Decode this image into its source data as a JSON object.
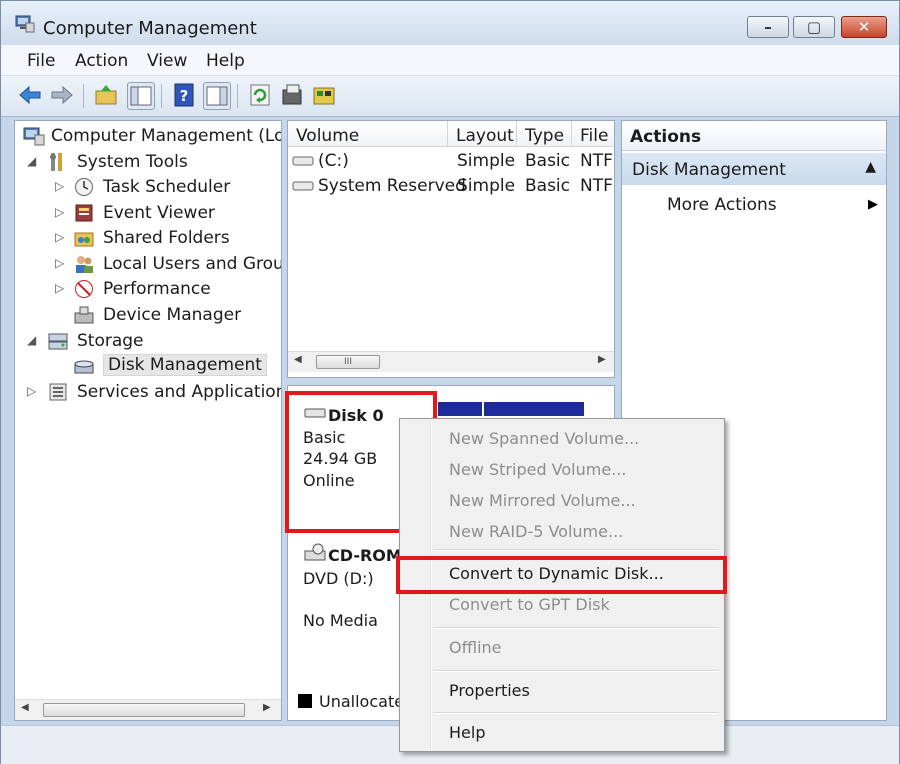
{
  "window": {
    "title": "Computer Management",
    "min_label": "–",
    "max_label": "▢",
    "close_label": "✕"
  },
  "menu": [
    "File",
    "Action",
    "View",
    "Help"
  ],
  "tree": {
    "root": "Computer Management (Local",
    "system_tools": "System Tools",
    "task_scheduler": "Task Scheduler",
    "event_viewer": "Event Viewer",
    "shared_folders": "Shared Folders",
    "local_users": "Local Users and Groups",
    "performance": "Performance",
    "device_manager": "Device Manager",
    "storage": "Storage",
    "disk_management": "Disk Management",
    "services": "Services and Applications"
  },
  "volumes": {
    "headers": [
      "Volume",
      "Layout",
      "Type",
      "File S"
    ],
    "rows": [
      [
        "(C:)",
        "Simple",
        "Basic",
        "NTF"
      ],
      [
        "System Reserved",
        "Simple",
        "Basic",
        "NTF"
      ]
    ]
  },
  "disk0": {
    "name": "Disk 0",
    "type": "Basic",
    "size": "24.94 GB",
    "status": "Online"
  },
  "cdrom": {
    "name": "CD-ROM",
    "drive": "DVD (D:)",
    "media": "No Media"
  },
  "legend": {
    "unallocated": "Unallocate"
  },
  "actions": {
    "header": "Actions",
    "section": "Disk Management",
    "more": "More Actions"
  },
  "context_menu": {
    "new_spanned": "New Spanned Volume...",
    "new_striped": "New Striped Volume...",
    "new_mirrored": "New Mirrored Volume...",
    "new_raid5": "New RAID-5 Volume...",
    "convert_dynamic": "Convert to Dynamic Disk...",
    "convert_gpt": "Convert to GPT Disk",
    "offline": "Offline",
    "properties": "Properties",
    "help": "Help"
  },
  "scroll_thumb_glyph": "III",
  "colors": {
    "highlight_red": "#e11919",
    "partition_blue": "#1d2a9a",
    "title_bar": "#cfdced"
  }
}
